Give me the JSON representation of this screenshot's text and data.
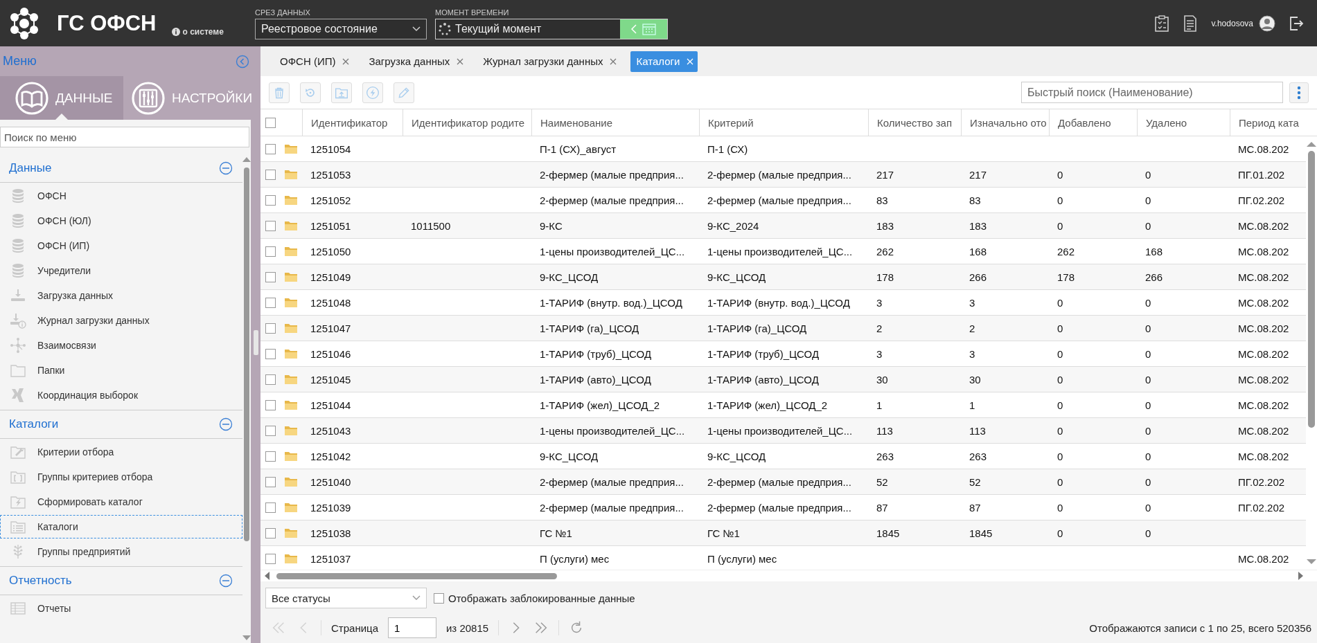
{
  "app": {
    "title": "ГС ОФСН",
    "about": "о системе"
  },
  "data_slice": {
    "label": "СРЕЗ ДАННЫХ",
    "value": "Реестровое состояние"
  },
  "time_moment": {
    "label": "МОМЕНТ ВРЕМЕНИ",
    "value": "Текущий момент"
  },
  "user": {
    "name": "v.hodosova"
  },
  "sidebar": {
    "title": "Меню",
    "tabs": [
      {
        "label": "ДАННЫЕ",
        "kind": "book",
        "selected": true
      },
      {
        "label": "НАСТРОЙКИ",
        "kind": "sliders",
        "selected": false
      }
    ],
    "search": {
      "placeholder": "Поиск по меню"
    },
    "sections": [
      {
        "title": "Данные",
        "expanded": true,
        "items": [
          {
            "label": "ОФСН",
            "kind": "database",
            "selected": false
          },
          {
            "label": "ОФСН (ЮЛ)",
            "kind": "database",
            "selected": false
          },
          {
            "label": "ОФСН (ИП)",
            "kind": "database",
            "selected": false
          },
          {
            "label": "Учредители",
            "kind": "database",
            "selected": false
          },
          {
            "label": "Загрузка данных",
            "kind": "download",
            "selected": false
          },
          {
            "label": "Журнал загрузки данных",
            "kind": "download-info",
            "selected": false
          },
          {
            "label": "Взаимосвязи",
            "kind": "network",
            "selected": false
          },
          {
            "label": "Папки",
            "kind": "folder",
            "selected": false
          },
          {
            "label": "Координация выборок",
            "kind": "x-shape",
            "selected": false
          }
        ]
      },
      {
        "title": "Каталоги",
        "expanded": true,
        "items": [
          {
            "label": "Критерии отбора",
            "kind": "folder-wrench",
            "selected": false
          },
          {
            "label": "Группы критериев отбора",
            "kind": "folder-bracket",
            "selected": false
          },
          {
            "label": "Сформировать каталог",
            "kind": "folder-lightning",
            "selected": false
          },
          {
            "label": "Каталоги",
            "kind": "folder-list",
            "selected": true
          },
          {
            "label": "Группы предприятий",
            "kind": "tree",
            "selected": false
          }
        ]
      },
      {
        "title": "Отчетность",
        "expanded": true,
        "items": [
          {
            "label": "Отчеты",
            "kind": "table",
            "selected": false
          }
        ]
      }
    ]
  },
  "doc_tabs": [
    {
      "label": "ОФСН (ИП)",
      "selected": false
    },
    {
      "label": "Загрузка данных",
      "selected": false
    },
    {
      "label": "Журнал загрузки данных",
      "selected": false
    },
    {
      "label": "Каталоги",
      "selected": true
    }
  ],
  "toolbar": {
    "buttons": [
      {
        "kind": "delete",
        "disabled": true
      },
      {
        "kind": "restore",
        "disabled": true
      },
      {
        "kind": "upload",
        "disabled": true
      },
      {
        "kind": "action",
        "disabled": true
      },
      {
        "kind": "edit",
        "disabled": true
      }
    ],
    "search": {
      "placeholder": "Быстрый поиск (Наименование)"
    }
  },
  "table": {
    "header_checked": false,
    "columns": [
      "Идентификатор",
      "Идентификатор родите",
      "Наименование",
      "Критерий",
      "Количество зап",
      "Изначально ото",
      "Добавлено",
      "Удалено",
      "Период ката"
    ],
    "rows": [
      {
        "checked": false,
        "cells": [
          "1251054",
          null,
          "П-1 (СХ)_август",
          "П-1 (СХ)",
          null,
          null,
          null,
          null,
          "МС.08.202"
        ]
      },
      {
        "checked": false,
        "cells": [
          "1251053",
          null,
          "2-фермер (малые предприя...",
          "2-фермер (малые предприя...",
          "217",
          "217",
          "0",
          "0",
          "ПГ.01.202"
        ]
      },
      {
        "checked": false,
        "cells": [
          "1251052",
          null,
          "2-фермер (малые предприя...",
          "2-фермер (малые предприя...",
          "83",
          "83",
          "0",
          "0",
          "ПГ.02.202"
        ]
      },
      {
        "checked": false,
        "cells": [
          "1251051",
          "1011500",
          "9-КС",
          "9-КС_2024",
          "183",
          "183",
          "0",
          "0",
          "МС.08.202"
        ]
      },
      {
        "checked": false,
        "cells": [
          "1251050",
          null,
          "1-цены производителей_ЦС...",
          "1-цены производителей_ЦС...",
          "262",
          "168",
          "262",
          "168",
          "МС.08.202"
        ]
      },
      {
        "checked": false,
        "cells": [
          "1251049",
          null,
          "9-КС_ЦСОД",
          "9-КС_ЦСОД",
          "178",
          "266",
          "178",
          "266",
          "МС.08.202"
        ]
      },
      {
        "checked": false,
        "cells": [
          "1251048",
          null,
          "1-ТАРИФ (внутр. вод.)_ЦСОД",
          "1-ТАРИФ (внутр. вод.)_ЦСОД",
          "3",
          "3",
          "0",
          "0",
          "МС.08.202"
        ]
      },
      {
        "checked": false,
        "cells": [
          "1251047",
          null,
          "1-ТАРИФ (га)_ЦСОД",
          "1-ТАРИФ (га)_ЦСОД",
          "2",
          "2",
          "0",
          "0",
          "МС.08.202"
        ]
      },
      {
        "checked": false,
        "cells": [
          "1251046",
          null,
          "1-ТАРИФ (труб)_ЦСОД",
          "1-ТАРИФ (труб)_ЦСОД",
          "3",
          "3",
          "0",
          "0",
          "МС.08.202"
        ]
      },
      {
        "checked": false,
        "cells": [
          "1251045",
          null,
          "1-ТАРИФ (авто)_ЦСОД",
          "1-ТАРИФ (авто)_ЦСОД",
          "30",
          "30",
          "0",
          "0",
          "МС.08.202"
        ]
      },
      {
        "checked": false,
        "cells": [
          "1251044",
          null,
          "1-ТАРИФ (жел)_ЦСОД_2",
          "1-ТАРИФ (жел)_ЦСОД_2",
          "1",
          "1",
          "0",
          "0",
          "МС.08.202"
        ]
      },
      {
        "checked": false,
        "cells": [
          "1251043",
          null,
          "1-цены производителей_ЦС...",
          "1-цены производителей_ЦС...",
          "113",
          "113",
          "0",
          "0",
          "МС.08.202"
        ]
      },
      {
        "checked": false,
        "cells": [
          "1251042",
          null,
          "9-КС_ЦСОД",
          "9-КС_ЦСОД",
          "263",
          "263",
          "0",
          "0",
          "МС.08.202"
        ]
      },
      {
        "checked": false,
        "cells": [
          "1251040",
          null,
          "2-фермер (малые предприя...",
          "2-фермер (малые предприя...",
          "52",
          "52",
          "0",
          "0",
          "ПГ.02.202"
        ]
      },
      {
        "checked": false,
        "cells": [
          "1251039",
          null,
          "2-фермер (малые предприя...",
          "2-фермер (малые предприя...",
          "87",
          "87",
          "0",
          "0",
          "ПГ.02.202"
        ]
      },
      {
        "checked": false,
        "cells": [
          "1251038",
          null,
          "ГС №1",
          "ГС №1",
          "1845",
          "1845",
          "0",
          "0",
          null
        ]
      },
      {
        "checked": false,
        "cells": [
          "1251037",
          null,
          "П (услуги) мес",
          "П (услуги) мес",
          null,
          null,
          null,
          null,
          "МС.08.202"
        ]
      }
    ]
  },
  "footer": {
    "status_filter": "Все статусы",
    "show_blocked": {
      "label": "Отображать заблокированные данные",
      "checked": false
    },
    "pager": {
      "page_label": "Страница",
      "page": "1",
      "of": "из 20815",
      "buttons": [
        {
          "kind": "first",
          "disabled": true
        },
        {
          "kind": "prev",
          "disabled": true
        },
        {
          "kind": "next",
          "disabled": false
        },
        {
          "kind": "last",
          "disabled": false
        },
        {
          "kind": "refresh",
          "disabled": false
        }
      ],
      "summary": "Отображаются записи с 1 по 25, всего 520356"
    }
  }
}
